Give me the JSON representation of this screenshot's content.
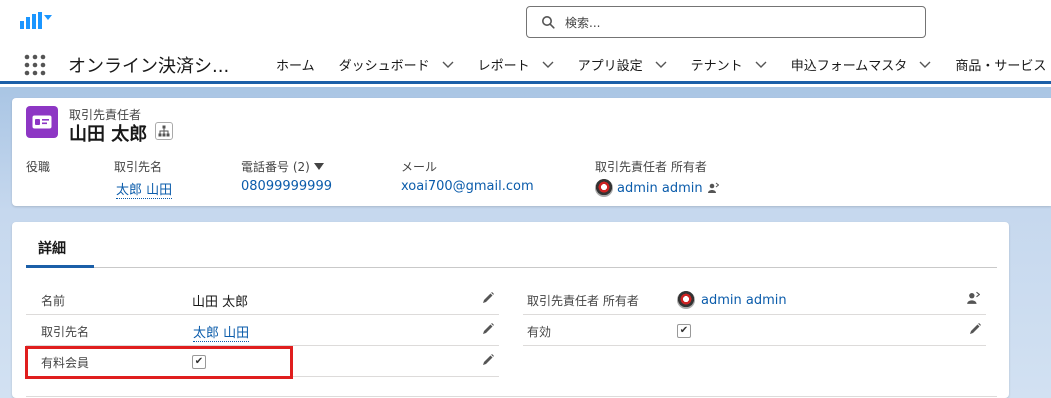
{
  "header": {
    "search_placeholder": "検索...",
    "app_name": "オンライン決済シ...",
    "nav": [
      {
        "label": "ホーム",
        "has_menu": false
      },
      {
        "label": "ダッシュボード",
        "has_menu": true
      },
      {
        "label": "レポート",
        "has_menu": true
      },
      {
        "label": "アプリ設定",
        "has_menu": true
      },
      {
        "label": "テナント",
        "has_menu": true
      },
      {
        "label": "申込フォームマスタ",
        "has_menu": true
      },
      {
        "label": "商品・サービス",
        "has_menu": false
      }
    ]
  },
  "record": {
    "type_label": "取引先責任者",
    "name": "山田 太郎",
    "icon_color": "#8d36c4"
  },
  "highlights": {
    "title_label": "役職",
    "account_label": "取引先名",
    "account_value": "太郎 山田",
    "phone_label": "電話番号 (2)",
    "phone_value": "08099999999",
    "email_label": "メール",
    "email_value": "xoai700@gmail.com",
    "owner_label": "取引先責任者 所有者",
    "owner_value": "admin admin"
  },
  "details": {
    "tab_label": "詳細",
    "left": [
      {
        "label": "名前",
        "value": "山田 太郎",
        "type": "text"
      },
      {
        "label": "取引先名",
        "value": "太郎 山田",
        "type": "link"
      },
      {
        "label": "有料会員",
        "value": "✔",
        "type": "checkbox"
      }
    ],
    "right": [
      {
        "label": "取引先責任者 所有者",
        "value": "admin admin",
        "type": "owner"
      },
      {
        "label": "有効",
        "value": "✔",
        "type": "checkbox"
      }
    ]
  },
  "colors": {
    "brand_blue": "#1b5fa8",
    "link": "#0b5cab",
    "highlight_box": "#e01e1e"
  }
}
